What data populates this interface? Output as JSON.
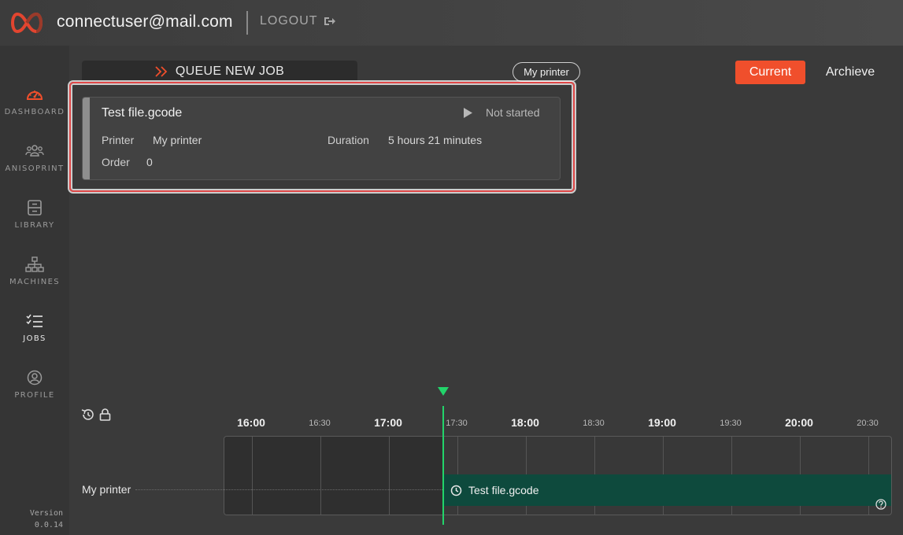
{
  "header": {
    "user_email": "connectuser@mail.com",
    "logout_label": "LOGOUT"
  },
  "sidebar": {
    "items": [
      {
        "label": "DASHBOARD",
        "icon": "dashboard-gauge-icon"
      },
      {
        "label": "ANISOPRINT",
        "icon": "users-group-icon"
      },
      {
        "label": "LIBRARY",
        "icon": "library-drawer-icon"
      },
      {
        "label": "MACHINES",
        "icon": "network-hierarchy-icon"
      },
      {
        "label": "JOBS",
        "icon": "checklist-icon",
        "active": true
      },
      {
        "label": "PROFILE",
        "icon": "user-circle-icon"
      }
    ],
    "version_label": "Version",
    "version": "0.0.14"
  },
  "toolbar": {
    "queue_label": "QUEUE NEW JOB",
    "printer_filter": "My printer",
    "tabs": {
      "current": "Current",
      "archive": "Archieve"
    }
  },
  "job": {
    "title": "Test file.gcode",
    "status": "Not started",
    "printer_label": "Printer",
    "printer_value": "My printer",
    "duration_label": "Duration",
    "duration_value": "5 hours 21 minutes",
    "order_label": "Order",
    "order_value": "0"
  },
  "timeline": {
    "ticks": [
      {
        "label": "16:00",
        "major": true
      },
      {
        "label": "16:30",
        "major": false
      },
      {
        "label": "17:00",
        "major": true
      },
      {
        "label": "17:30",
        "major": false
      },
      {
        "label": "18:00",
        "major": true
      },
      {
        "label": "18:30",
        "major": false
      },
      {
        "label": "19:00",
        "major": true
      },
      {
        "label": "19:30",
        "major": false
      },
      {
        "label": "20:00",
        "major": true
      },
      {
        "label": "20:30",
        "major": false
      }
    ],
    "row_label": "My printer",
    "bar_label": "Test file.gcode",
    "now_color": "#22d46a",
    "bar_color": "#0e4a3d",
    "accent_color": "#f04f2c"
  }
}
